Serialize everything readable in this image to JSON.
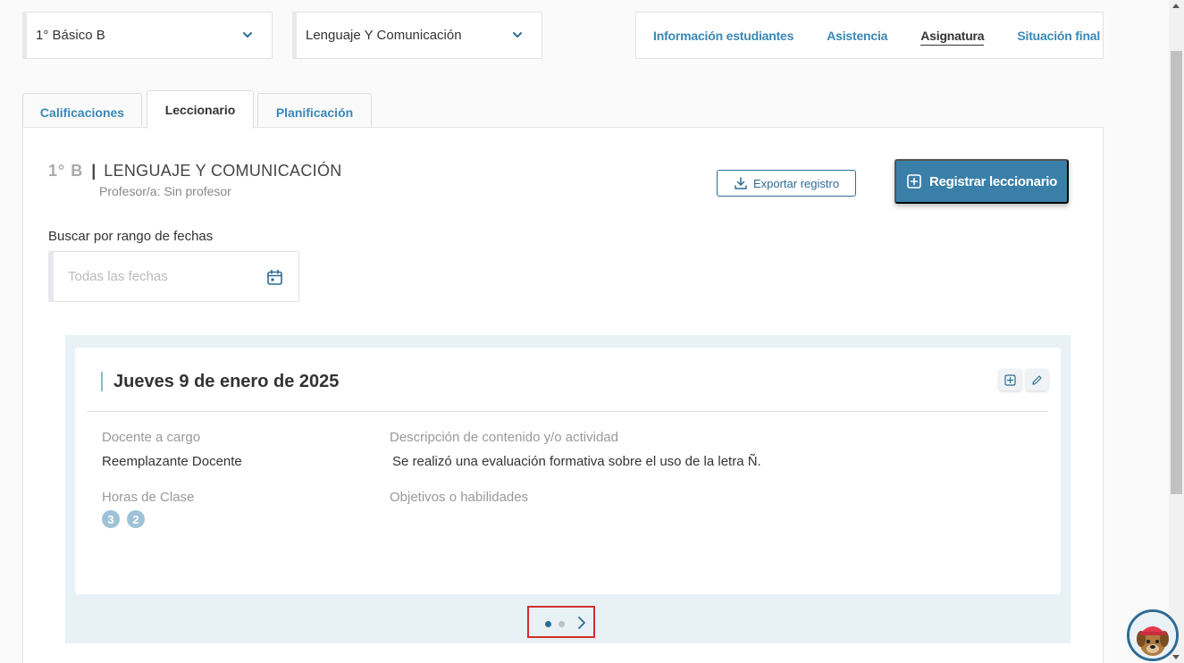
{
  "filters": {
    "course_select": {
      "value": "1° Básico B"
    },
    "subject_select": {
      "value": "Lenguaje Y Comunicación"
    }
  },
  "top_nav": {
    "items": [
      {
        "label": "Información estudiantes",
        "active": false
      },
      {
        "label": "Asistencia",
        "active": false
      },
      {
        "label": "Asignatura",
        "active": true
      },
      {
        "label": "Situación final",
        "active": false
      }
    ]
  },
  "tabs": [
    {
      "label": "Calificaciones",
      "active": false
    },
    {
      "label": "Leccionario",
      "active": true
    },
    {
      "label": "Planificación",
      "active": false
    }
  ],
  "header": {
    "course_code": "1° B",
    "separator": "|",
    "subject_name": "LENGUAJE Y COMUNICACIÓN",
    "teacher": "Profesor/a: Sin profesor"
  },
  "actions": {
    "export_label": "Exportar registro",
    "register_label": "Registrar leccionario"
  },
  "date_search": {
    "label": "Buscar por rango de fechas",
    "placeholder": "Todas las fechas"
  },
  "entry": {
    "date": "Jueves 9 de enero de 2025",
    "teacher_label": "Docente a cargo",
    "teacher_value": "Reemplazante Docente",
    "description_label": "Descripción de contenido y/o actividad",
    "description_value": "Se realizó una evaluación formativa sobre el uso de la letra Ñ.",
    "hours_label": "Horas de Clase",
    "hours": [
      "3",
      "2"
    ],
    "objectives_label": "Objetivos o habilidades"
  },
  "pager": {
    "current": 1,
    "total": 2
  },
  "colors": {
    "accent": "#3a7fa8",
    "link": "#3a88b6",
    "carousel_bg": "#e8f1f6",
    "highlight_border": "#d32f2f"
  }
}
